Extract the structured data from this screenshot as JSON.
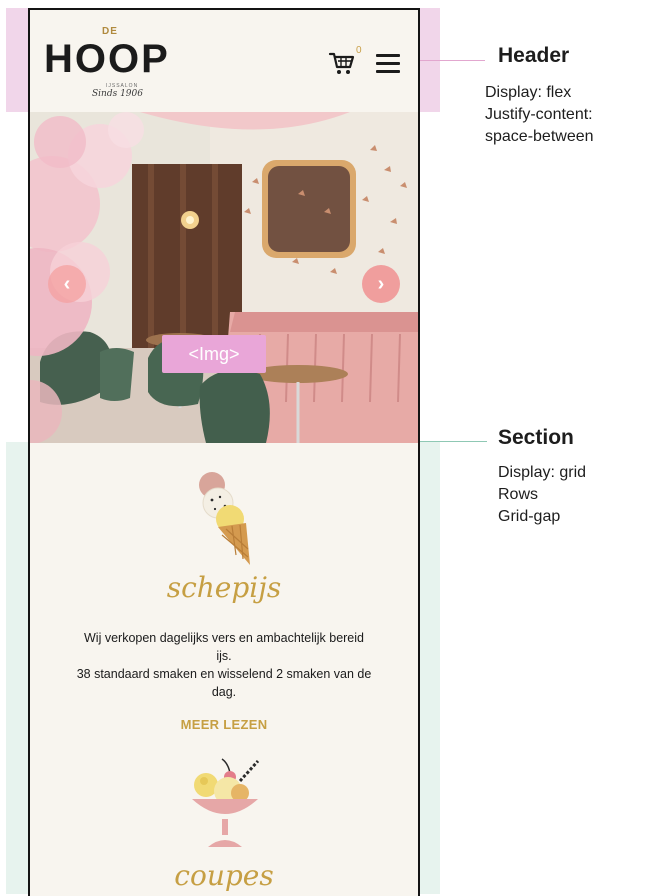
{
  "header": {
    "logo": {
      "de": "DE",
      "hoop": "HOOP",
      "sub": "IJSSALON",
      "since": "Sinds 1906"
    },
    "cart_count": "0"
  },
  "hero": {
    "img_tag": "<Img>",
    "prev_symbol": "‹",
    "next_symbol": "›"
  },
  "products": [
    {
      "title": "schepijs",
      "lines": [
        "Wij verkopen dagelijks vers en ambachtelijk bereid",
        "ijs.",
        "38 standaard smaken en wisselend 2 smaken van de",
        "dag."
      ],
      "more": "MEER LEZEN"
    },
    {
      "title": "coupes"
    }
  ],
  "annotations": {
    "header": {
      "title": "Header",
      "lines": [
        "Display: flex",
        "Justify-content:",
        "space-between"
      ]
    },
    "section": {
      "title": "Section",
      "lines": [
        "Display: grid",
        "Rows",
        "Grid-gap"
      ]
    }
  },
  "colors": {
    "accent_gold": "#c69f43",
    "header_highlight": "#f1d6ea",
    "section_highlight": "#e7f3ee",
    "img_tag": "#e9a6d8",
    "arrow": "#f09696"
  }
}
